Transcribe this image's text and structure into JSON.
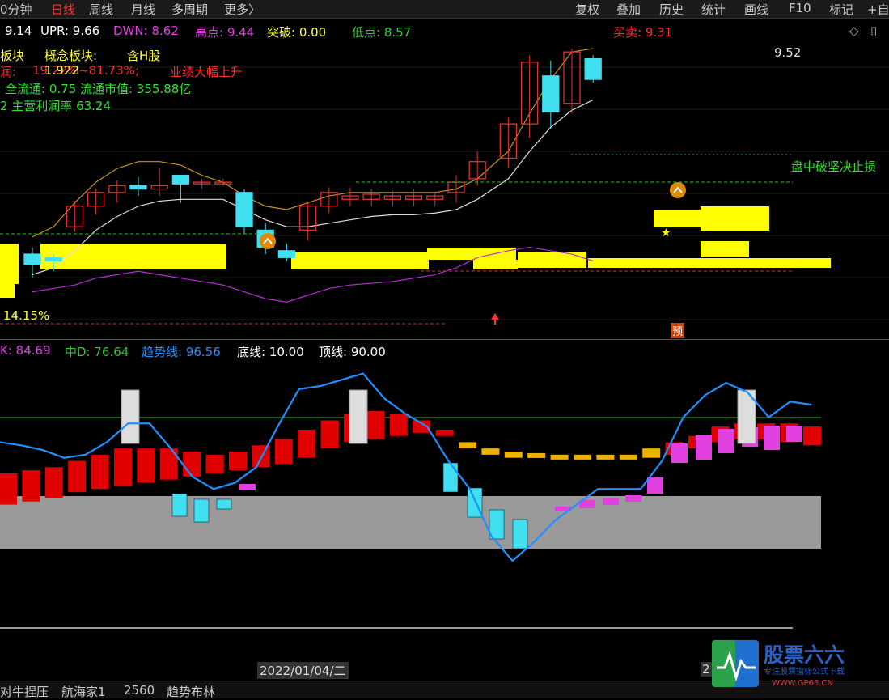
{
  "toolbar": {
    "items": [
      "0分钟",
      "日线",
      "周线",
      "月线",
      "多周期",
      "更多〉",
      "复权",
      "叠加",
      "历史",
      "统计",
      "画线",
      "F10",
      "标记",
      "+自"
    ],
    "active": "日线"
  },
  "main_panel": {
    "indicator_prefix": "9.14",
    "upr": "UPR: 9.66",
    "dwn": "DWN: 8.62",
    "high": "高点: 9.44",
    "breakout": "突破: 0.00",
    "low": "低点: 8.57",
    "buysell": "买卖: 9.31",
    "info_line1_a": "板块",
    "info_line1_b": "概念板块:",
    "info_line1_c": "含H股",
    "info_line2_a": "润:",
    "info_line2_b": "19.22%~81.73%;",
    "info_line2_c": "业绩大幅上升",
    "info_line2_overlay": "1.922",
    "info_line3": "全流通: 0.75 流通市值: 355.88亿",
    "info_line4": "2 主营利润率 63.24",
    "right_note": "盘中破坚决止损",
    "pct_label": "14.15%",
    "peak_label": "9.52",
    "pre_label": "预"
  },
  "sub_panel": {
    "k": "K: 84.69",
    "d": "中D: 76.64",
    "trend": "趋势线: 96.56",
    "bottom_line": "底线: 10.00",
    "top_line": "顶线: 90.00"
  },
  "date_label": "2022/01/04/二",
  "date_label_right": "2",
  "bottom_tabs": [
    "对牛捏压",
    "航海家1",
    "2560",
    "趋势布林"
  ],
  "logo": {
    "title": "股票六六",
    "sub": "专注股票指标公式下载",
    "url": "WWW.GP66.CN"
  },
  "colors": {
    "up": "#e03030",
    "down": "#40e0f0",
    "yellow": "#ffff00",
    "trend": "#1e90ff",
    "k": "#e040e0",
    "d": "#30c030"
  },
  "chart_data": [
    {
      "type": "candlestick",
      "title": "",
      "ylim": [
        7.9,
        9.6
      ],
      "candles": [
        {
          "o": 8.32,
          "h": 8.36,
          "l": 8.18,
          "c": 8.26
        },
        {
          "o": 8.3,
          "h": 8.32,
          "l": 8.22,
          "c": 8.28
        },
        {
          "o": 8.48,
          "h": 8.63,
          "l": 8.45,
          "c": 8.6
        },
        {
          "o": 8.6,
          "h": 8.7,
          "l": 8.55,
          "c": 8.68
        },
        {
          "o": 8.68,
          "h": 8.75,
          "l": 8.62,
          "c": 8.72
        },
        {
          "o": 8.72,
          "h": 8.77,
          "l": 8.66,
          "c": 8.7
        },
        {
          "o": 8.7,
          "h": 8.82,
          "l": 8.66,
          "c": 8.72
        },
        {
          "o": 8.78,
          "h": 8.78,
          "l": 8.62,
          "c": 8.73
        },
        {
          "o": 8.74,
          "h": 8.76,
          "l": 8.7,
          "c": 8.74
        },
        {
          "o": 8.74,
          "h": 8.76,
          "l": 8.72,
          "c": 8.74
        },
        {
          "o": 8.68,
          "h": 8.7,
          "l": 8.44,
          "c": 8.48
        },
        {
          "o": 8.46,
          "h": 8.5,
          "l": 8.32,
          "c": 8.36
        },
        {
          "o": 8.34,
          "h": 8.38,
          "l": 8.28,
          "c": 8.3
        },
        {
          "o": 8.46,
          "h": 8.62,
          "l": 8.4,
          "c": 8.6
        },
        {
          "o": 8.6,
          "h": 8.71,
          "l": 8.56,
          "c": 8.68
        },
        {
          "o": 8.64,
          "h": 8.71,
          "l": 8.6,
          "c": 8.66
        },
        {
          "o": 8.64,
          "h": 8.7,
          "l": 8.6,
          "c": 8.67
        },
        {
          "o": 8.64,
          "h": 8.69,
          "l": 8.6,
          "c": 8.66
        },
        {
          "o": 8.64,
          "h": 8.7,
          "l": 8.6,
          "c": 8.66
        },
        {
          "o": 8.64,
          "h": 8.68,
          "l": 8.6,
          "c": 8.66
        },
        {
          "o": 8.68,
          "h": 8.78,
          "l": 8.62,
          "c": 8.74
        },
        {
          "o": 8.76,
          "h": 8.92,
          "l": 8.72,
          "c": 8.86
        },
        {
          "o": 8.88,
          "h": 9.12,
          "l": 8.82,
          "c": 9.08
        },
        {
          "o": 9.08,
          "h": 9.48,
          "l": 9.0,
          "c": 9.44
        },
        {
          "o": 9.36,
          "h": 9.45,
          "l": 9.05,
          "c": 9.15
        },
        {
          "o": 9.2,
          "h": 9.52,
          "l": 9.14,
          "c": 9.5
        },
        {
          "o": 9.46,
          "h": 9.48,
          "l": 9.32,
          "c": 9.34
        }
      ],
      "upper_band": [
        8.42,
        8.48,
        8.62,
        8.74,
        8.82,
        8.86,
        8.86,
        8.84,
        8.78,
        8.74,
        8.66,
        8.6,
        8.58,
        8.62,
        8.66,
        8.68,
        8.68,
        8.68,
        8.68,
        8.68,
        8.7,
        8.76,
        8.92,
        9.14,
        9.34,
        9.5,
        9.52
      ],
      "mid_band": [
        8.2,
        8.24,
        8.34,
        8.46,
        8.54,
        8.6,
        8.63,
        8.64,
        8.64,
        8.64,
        8.58,
        8.52,
        8.48,
        8.48,
        8.5,
        8.52,
        8.54,
        8.55,
        8.55,
        8.56,
        8.58,
        8.64,
        8.76,
        8.92,
        9.06,
        9.16,
        9.22
      ],
      "lower_band": [
        8.1,
        8.12,
        8.14,
        8.18,
        8.2,
        8.22,
        8.2,
        8.18,
        8.16,
        8.14,
        8.1,
        8.06,
        8.04,
        8.08,
        8.12,
        8.14,
        8.15,
        8.16,
        8.18,
        8.2,
        8.24,
        8.3,
        8.34,
        8.36,
        8.34,
        8.32,
        8.28
      ],
      "lines": {
        "green_dashed_high": 9.06,
        "green_dashed_low": 8.44,
        "red_dashed": 8.14
      }
    },
    {
      "type": "bar",
      "title": "",
      "ylim": [
        -30,
        110
      ],
      "bars": [
        {
          "top": 40,
          "bottom": 20
        },
        {
          "top": 42,
          "bottom": 22
        },
        {
          "top": 44,
          "bottom": 24
        },
        {
          "top": 48,
          "bottom": 28
        },
        {
          "top": 52,
          "bottom": 30
        },
        {
          "top": 56,
          "bottom": 32
        },
        {
          "top": 56,
          "bottom": 34
        },
        {
          "top": 56,
          "bottom": 36
        },
        {
          "top": 54,
          "bottom": 38
        },
        {
          "top": 52,
          "bottom": 40
        },
        {
          "top": 54,
          "bottom": 42
        },
        {
          "top": 58,
          "bottom": 44
        },
        {
          "top": 62,
          "bottom": 46
        },
        {
          "top": 68,
          "bottom": 50
        },
        {
          "top": 74,
          "bottom": 56
        },
        {
          "top": 78,
          "bottom": 60
        },
        {
          "top": 80,
          "bottom": 62
        },
        {
          "top": 78,
          "bottom": 64
        },
        {
          "top": 74,
          "bottom": 66
        },
        {
          "top": 68,
          "bottom": 64
        },
        {
          "top": 60,
          "bottom": 56
        },
        {
          "top": 56,
          "bottom": 52
        },
        {
          "top": 54,
          "bottom": 50
        },
        {
          "top": 53,
          "bottom": 50
        },
        {
          "top": 52,
          "bottom": 50
        },
        {
          "top": 52,
          "bottom": 50
        },
        {
          "top": 52,
          "bottom": 50
        },
        {
          "top": 52,
          "bottom": 50
        },
        {
          "top": 56,
          "bottom": 50
        },
        {
          "top": 60,
          "bottom": 52
        },
        {
          "top": 64,
          "bottom": 56
        },
        {
          "top": 70,
          "bottom": 60
        },
        {
          "top": 72,
          "bottom": 62
        },
        {
          "top": 72,
          "bottom": 62
        },
        {
          "top": 72,
          "bottom": 60
        },
        {
          "top": 70,
          "bottom": 58
        }
      ],
      "trend_line": [
        60,
        58,
        55,
        50,
        52,
        60,
        72,
        72,
        56,
        38,
        30,
        34,
        44,
        70,
        94,
        96,
        100,
        104,
        88,
        78,
        70,
        48,
        30,
        0,
        -16,
        -4,
        10,
        20,
        30,
        30,
        30,
        48,
        76,
        90,
        98,
        92,
        76,
        86,
        84
      ]
    }
  ]
}
